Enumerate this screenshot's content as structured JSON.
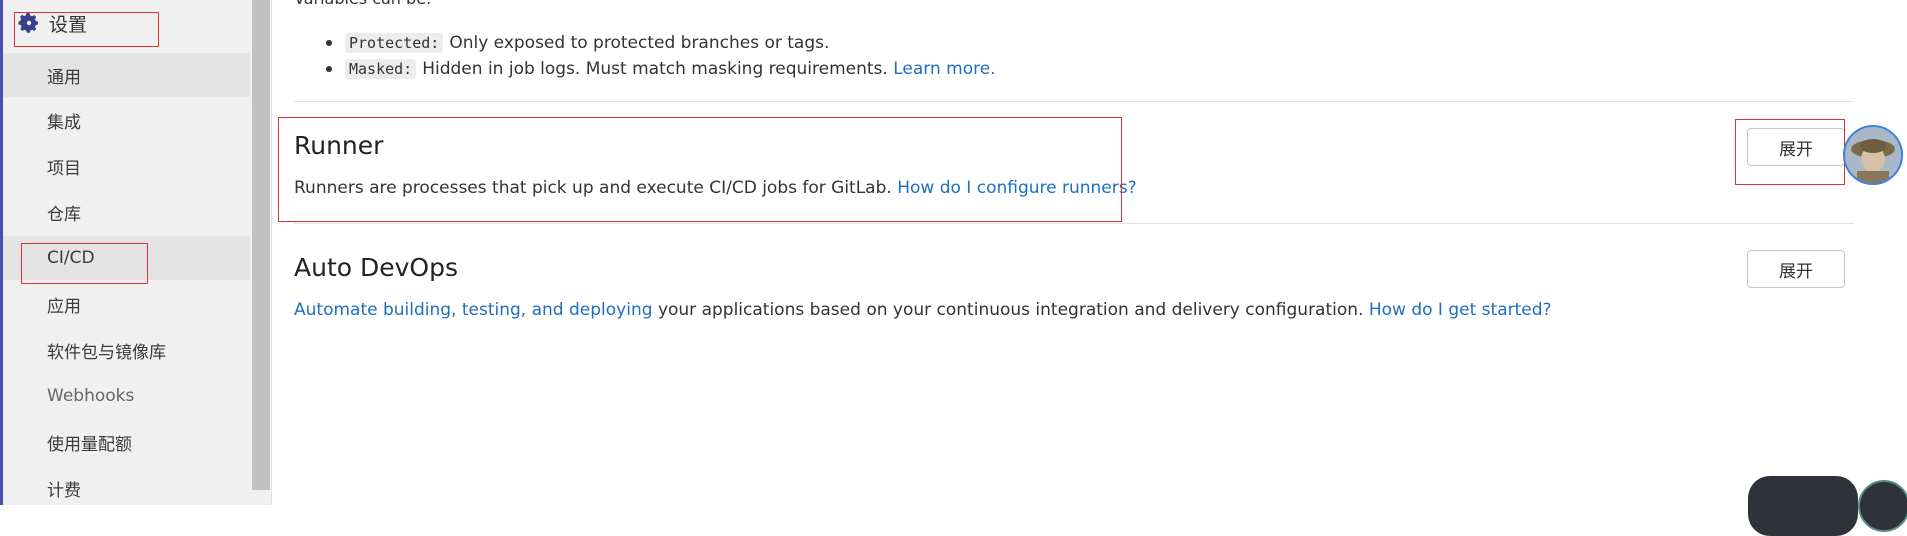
{
  "sidebar": {
    "title": "设置",
    "items": [
      {
        "label": "通用"
      },
      {
        "label": "集成"
      },
      {
        "label": "项目"
      },
      {
        "label": "仓库"
      },
      {
        "label": "CI/CD"
      },
      {
        "label": "应用"
      },
      {
        "label": "软件包与镜像库"
      },
      {
        "label": "Webhooks"
      },
      {
        "label": "使用量配额"
      },
      {
        "label": "计费"
      }
    ]
  },
  "variables": {
    "truncated_intro": "Variables can be:",
    "bullets": [
      {
        "keyword": "Protected:",
        "text": "Only exposed to protected branches or tags."
      },
      {
        "keyword": "Masked:",
        "text": "Hidden in job logs. Must match masking requirements.",
        "link": "Learn more."
      }
    ]
  },
  "runner": {
    "title": "Runner",
    "description": "Runners are processes that pick up and execute CI/CD jobs for GitLab.",
    "link": "How do I configure runners?",
    "expand_label": "展开"
  },
  "auto_devops": {
    "title": "Auto DevOps",
    "link_lead": "Automate building, testing, and deploying",
    "description": "your applications based on your continuous integration and delivery configuration.",
    "link_help": "How do I get started?",
    "expand_label": "展开"
  },
  "colors": {
    "link": "#1f6fbf",
    "highlight": "#e03434",
    "sidebar_bg": "#f0f0f0",
    "accent": "#4a4db0"
  },
  "icons": {
    "settings": "gear-icon"
  }
}
